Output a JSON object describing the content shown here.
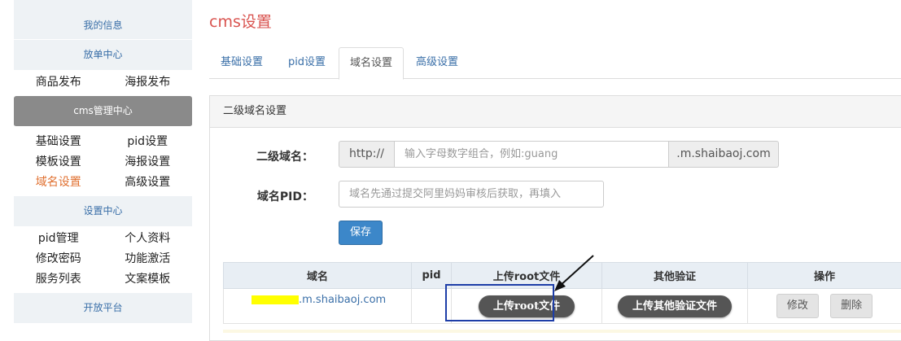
{
  "sidebar": {
    "my_info": "我的信息",
    "order_center": "放单中心",
    "order_links": [
      "商品发布",
      "海报发布"
    ],
    "cms_center": "cms管理中心",
    "cms_links": [
      "基础设置",
      "pid设置",
      "模板设置",
      "海报设置",
      "域名设置",
      "高级设置"
    ],
    "settings_center": "设置中心",
    "settings_links": [
      "pid管理",
      "个人资料",
      "修改密码",
      "功能激活",
      "服务列表",
      "文案模板"
    ],
    "open_platform": "开放平台"
  },
  "page": {
    "title": "cms设置"
  },
  "tabs": [
    "基础设置",
    "pid设置",
    "域名设置",
    "高级设置"
  ],
  "panel": {
    "title": "二级域名设置"
  },
  "form": {
    "subdomain_label": "二级域名：",
    "prefix": "http://",
    "subdomain_placeholder": "输入字母数字组合，例如:guang",
    "suffix": ".m.shaibaoj.com",
    "pid_label": "域名PID：",
    "pid_placeholder": "域名先通过提交阿里妈妈审核后获取，再填入",
    "save": "保存"
  },
  "table": {
    "headers": [
      "域名",
      "pid",
      "上传root文件",
      "其他验证",
      "操作"
    ],
    "row": {
      "domain_suffix": ".m.shaibaoj.com",
      "pid": "",
      "upload_root": "上传root文件",
      "upload_other": "上传其他验证文件",
      "edit": "修改",
      "delete": "删除"
    }
  },
  "colors": {
    "title_red": "#d9534f",
    "link_blue": "#3a6fa8",
    "primary": "#3c87c9",
    "annotation_box": "#1e3ea8",
    "highlight": "#ffff00"
  }
}
